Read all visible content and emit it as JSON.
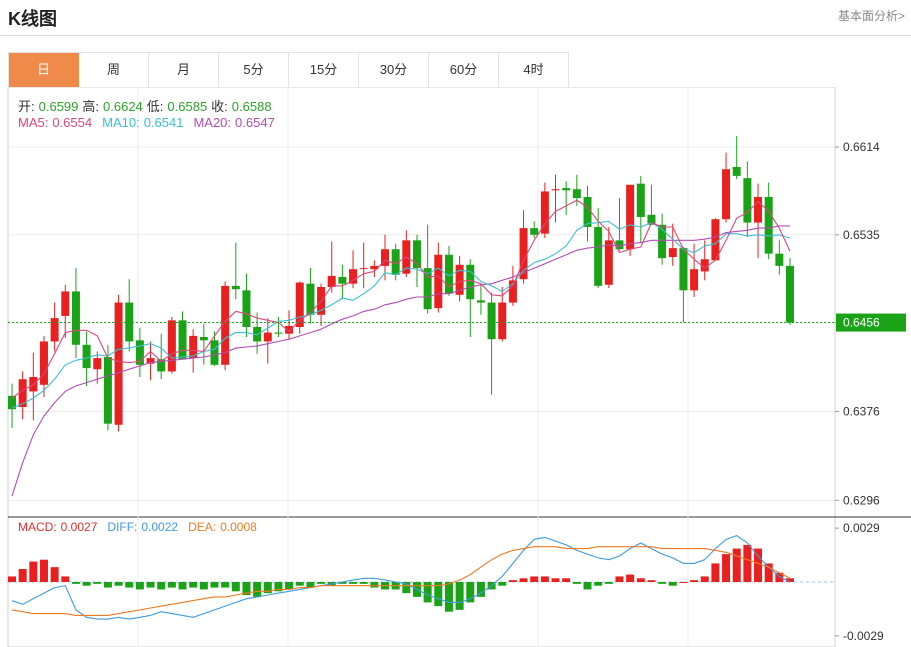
{
  "header": {
    "title": "K线图",
    "more_label": "基本面分析>"
  },
  "tabs": [
    {
      "label": "日",
      "active": true
    },
    {
      "label": "周",
      "active": false
    },
    {
      "label": "月",
      "active": false
    },
    {
      "label": "5分",
      "active": false
    },
    {
      "label": "15分",
      "active": false
    },
    {
      "label": "30分",
      "active": false
    },
    {
      "label": "60分",
      "active": false
    },
    {
      "label": "4时",
      "active": false
    }
  ],
  "ohlc": [
    {
      "label": "开:",
      "value": "0.6599"
    },
    {
      "label": "高:",
      "value": "0.6624"
    },
    {
      "label": "低:",
      "value": "0.6585"
    },
    {
      "label": "收:",
      "value": "0.6588"
    }
  ],
  "ma": [
    {
      "label": "MA5:",
      "value": "0.6554",
      "color": "#e0457b"
    },
    {
      "label": "MA10:",
      "value": "0.6541",
      "color": "#3cbfd6"
    },
    {
      "label": "MA20:",
      "value": "0.6547",
      "color": "#b14db5"
    }
  ],
  "macd_info": [
    {
      "label": "MACD:",
      "value": "0.0027",
      "color": "#e0302a"
    },
    {
      "label": "DIFF:",
      "value": "0.0022",
      "color": "#3c9be0"
    },
    {
      "label": "DEA:",
      "value": "0.0008",
      "color": "#f07a22"
    }
  ],
  "colors": {
    "up": "#e8201f",
    "down": "#1aa317",
    "ma5": "#e0457b",
    "ma10": "#3cbfd6",
    "ma20": "#b14db5",
    "diff": "#3c9be0",
    "dea": "#f07a22",
    "last": "#1aa317"
  },
  "chart_data": {
    "type": "candlestick",
    "price_axis": {
      "ticks": [
        "0.6614",
        "0.6535",
        "0.6456",
        "0.6376",
        "0.6296"
      ],
      "ylim": [
        0.6281,
        0.6668
      ]
    },
    "last_price": "0.6456",
    "candles": [
      [
        0.639,
        0.6401,
        0.6361,
        0.6378
      ],
      [
        0.638,
        0.6412,
        0.6369,
        0.6405
      ],
      [
        0.6394,
        0.6429,
        0.6368,
        0.6407
      ],
      [
        0.64,
        0.6444,
        0.6389,
        0.6439
      ],
      [
        0.6439,
        0.6474,
        0.643,
        0.646
      ],
      [
        0.6462,
        0.649,
        0.6442,
        0.6484
      ],
      [
        0.6484,
        0.6505,
        0.6424,
        0.6436
      ],
      [
        0.6436,
        0.6448,
        0.6399,
        0.6415
      ],
      [
        0.6414,
        0.643,
        0.6401,
        0.6424
      ],
      [
        0.6425,
        0.6436,
        0.6359,
        0.6365
      ],
      [
        0.6364,
        0.6481,
        0.6358,
        0.6474
      ],
      [
        0.6474,
        0.6495,
        0.643,
        0.6439
      ],
      [
        0.644,
        0.6451,
        0.6407,
        0.6418
      ],
      [
        0.6419,
        0.6439,
        0.6404,
        0.6424
      ],
      [
        0.6423,
        0.6446,
        0.6405,
        0.6412
      ],
      [
        0.6412,
        0.6461,
        0.641,
        0.6458
      ],
      [
        0.6458,
        0.6466,
        0.6423,
        0.6423
      ],
      [
        0.6424,
        0.645,
        0.6411,
        0.6444
      ],
      [
        0.6443,
        0.6455,
        0.6418,
        0.644
      ],
      [
        0.644,
        0.6448,
        0.6417,
        0.6418
      ],
      [
        0.6418,
        0.6493,
        0.6413,
        0.6489
      ],
      [
        0.6489,
        0.6528,
        0.6477,
        0.6486
      ],
      [
        0.6485,
        0.65,
        0.6443,
        0.6452
      ],
      [
        0.6452,
        0.6465,
        0.6428,
        0.6439
      ],
      [
        0.6439,
        0.646,
        0.6419,
        0.6447
      ],
      [
        0.6447,
        0.6461,
        0.6443,
        0.6446
      ],
      [
        0.6446,
        0.6467,
        0.6441,
        0.6453
      ],
      [
        0.6452,
        0.6493,
        0.6446,
        0.6492
      ],
      [
        0.6491,
        0.6505,
        0.6455,
        0.6463
      ],
      [
        0.6463,
        0.6491,
        0.6453,
        0.6488
      ],
      [
        0.6488,
        0.6529,
        0.6483,
        0.6498
      ],
      [
        0.6497,
        0.6508,
        0.6477,
        0.6491
      ],
      [
        0.6491,
        0.6521,
        0.6487,
        0.6504
      ],
      [
        0.6505,
        0.6528,
        0.6487,
        0.6505
      ],
      [
        0.6504,
        0.6512,
        0.6497,
        0.6507
      ],
      [
        0.6507,
        0.6535,
        0.6494,
        0.6522
      ],
      [
        0.6522,
        0.6527,
        0.6494,
        0.6499
      ],
      [
        0.65,
        0.6539,
        0.6497,
        0.653
      ],
      [
        0.653,
        0.6535,
        0.6488,
        0.6505
      ],
      [
        0.6505,
        0.6544,
        0.6464,
        0.6468
      ],
      [
        0.6469,
        0.6528,
        0.6465,
        0.6517
      ],
      [
        0.6517,
        0.6525,
        0.648,
        0.6482
      ],
      [
        0.6481,
        0.6516,
        0.6475,
        0.6508
      ],
      [
        0.6508,
        0.6513,
        0.6443,
        0.6477
      ],
      [
        0.6476,
        0.649,
        0.6463,
        0.6474
      ],
      [
        0.6474,
        0.6483,
        0.6391,
        0.6441
      ],
      [
        0.6441,
        0.6488,
        0.6439,
        0.6474
      ],
      [
        0.6474,
        0.6507,
        0.6471,
        0.6494
      ],
      [
        0.6495,
        0.6557,
        0.6491,
        0.6541
      ],
      [
        0.6541,
        0.6547,
        0.6532,
        0.6535
      ],
      [
        0.6536,
        0.6582,
        0.6532,
        0.6574
      ],
      [
        0.6575,
        0.6589,
        0.6546,
        0.6576
      ],
      [
        0.6577,
        0.6583,
        0.6553,
        0.6575
      ],
      [
        0.6576,
        0.6589,
        0.6561,
        0.6568
      ],
      [
        0.6569,
        0.6579,
        0.6529,
        0.6542
      ],
      [
        0.6542,
        0.6559,
        0.6487,
        0.6489
      ],
      [
        0.649,
        0.6542,
        0.6487,
        0.653
      ],
      [
        0.653,
        0.6568,
        0.6521,
        0.6522
      ],
      [
        0.6522,
        0.6579,
        0.6516,
        0.658
      ],
      [
        0.6581,
        0.6588,
        0.6528,
        0.6551
      ],
      [
        0.6553,
        0.658,
        0.6545,
        0.6544
      ],
      [
        0.6544,
        0.6554,
        0.6508,
        0.6514
      ],
      [
        0.6515,
        0.6545,
        0.6507,
        0.6523
      ],
      [
        0.6523,
        0.6524,
        0.6456,
        0.6485
      ],
      [
        0.6485,
        0.6527,
        0.6479,
        0.6504
      ],
      [
        0.6502,
        0.653,
        0.6494,
        0.6513
      ],
      [
        0.6512,
        0.655,
        0.6513,
        0.6549
      ],
      [
        0.6549,
        0.6609,
        0.6546,
        0.6594
      ],
      [
        0.6596,
        0.6624,
        0.6585,
        0.6588
      ],
      [
        0.6586,
        0.6601,
        0.6533,
        0.6546
      ],
      [
        0.6546,
        0.6581,
        0.6514,
        0.6569
      ],
      [
        0.6569,
        0.6582,
        0.6513,
        0.6518
      ],
      [
        0.6518,
        0.653,
        0.6499,
        0.6507
      ],
      [
        0.6507,
        0.6514,
        0.6454,
        0.6456
      ]
    ],
    "ma5": [
      0.6388,
      0.6395,
      0.64,
      0.641,
      0.6428,
      0.6447,
      0.6449,
      0.6449,
      0.6444,
      0.6424,
      0.6421,
      0.642,
      0.6421,
      0.643,
      0.6421,
      0.6428,
      0.6431,
      0.6431,
      0.643,
      0.6444,
      0.6457,
      0.6466,
      0.6464,
      0.646,
      0.6458,
      0.6456,
      0.6448,
      0.6458,
      0.6465,
      0.6475,
      0.6489,
      0.6489,
      0.6494,
      0.65,
      0.6502,
      0.6512,
      0.6509,
      0.6515,
      0.6509,
      0.6497,
      0.6498,
      0.6488,
      0.6493,
      0.6494,
      0.6491,
      0.6481,
      0.648,
      0.6489,
      0.6512,
      0.653,
      0.6545,
      0.6556,
      0.6561,
      0.6566,
      0.656,
      0.6547,
      0.6538,
      0.6519,
      0.6522,
      0.6524,
      0.6546,
      0.6542,
      0.6542,
      0.6522,
      0.6513,
      0.6505,
      0.6512,
      0.653,
      0.655,
      0.6555,
      0.6565,
      0.6556,
      0.6541,
      0.652
    ],
    "ma10": [
      0.6379,
      0.6383,
      0.6388,
      0.6395,
      0.6405,
      0.6418,
      0.6422,
      0.6424,
      0.6427,
      0.6426,
      0.6432,
      0.6433,
      0.6435,
      0.6437,
      0.6433,
      0.6424,
      0.6425,
      0.6426,
      0.643,
      0.6432,
      0.6442,
      0.6447,
      0.6447,
      0.6445,
      0.6451,
      0.6457,
      0.6458,
      0.6461,
      0.6463,
      0.6467,
      0.6472,
      0.6478,
      0.6476,
      0.6482,
      0.6489,
      0.6501,
      0.6499,
      0.6505,
      0.6504,
      0.65,
      0.6505,
      0.6498,
      0.6503,
      0.6502,
      0.6493,
      0.6489,
      0.6484,
      0.6491,
      0.6503,
      0.651,
      0.6513,
      0.6518,
      0.6525,
      0.6539,
      0.6545,
      0.6546,
      0.6547,
      0.654,
      0.6544,
      0.6542,
      0.6546,
      0.654,
      0.6531,
      0.6522,
      0.6519,
      0.6525,
      0.6527,
      0.6536,
      0.6536,
      0.6534,
      0.6535,
      0.6534,
      0.6535,
      0.6532
    ],
    "ma20": [
      0.63,
      0.633,
      0.6355,
      0.6372,
      0.6384,
      0.6394,
      0.6399,
      0.6402,
      0.6405,
      0.6408,
      0.6411,
      0.6414,
      0.6417,
      0.642,
      0.6421,
      0.6422,
      0.6423,
      0.6424,
      0.6425,
      0.6427,
      0.6429,
      0.6433,
      0.6434,
      0.6435,
      0.6437,
      0.6439,
      0.6441,
      0.6444,
      0.6447,
      0.645,
      0.6455,
      0.6459,
      0.6462,
      0.6466,
      0.6468,
      0.6472,
      0.6474,
      0.6477,
      0.6479,
      0.6479,
      0.6482,
      0.6482,
      0.6485,
      0.6488,
      0.649,
      0.6491,
      0.6494,
      0.6497,
      0.6501,
      0.6505,
      0.6509,
      0.6513,
      0.6517,
      0.6521,
      0.6523,
      0.6524,
      0.6526,
      0.6525,
      0.6527,
      0.6528,
      0.653,
      0.653,
      0.653,
      0.653,
      0.653,
      0.6531,
      0.6533,
      0.6537,
      0.6538,
      0.6539,
      0.6541,
      0.6541,
      0.6543,
      0.6543
    ],
    "macd_axis": {
      "ticks": [
        "0.0029",
        "-0.0029"
      ],
      "ylim": [
        -0.0035,
        0.0035
      ]
    },
    "macd": [
      0.0003,
      0.0007,
      0.0011,
      0.0012,
      0.0008,
      0.0003,
      -0.0001,
      -0.0002,
      -0.0001,
      -0.0003,
      -0.0002,
      -0.0003,
      -0.0004,
      -0.0003,
      -0.0004,
      -0.0003,
      -0.0004,
      -0.0003,
      -0.0004,
      -0.0003,
      -0.0003,
      -0.0005,
      -0.0007,
      -0.0008,
      -0.0006,
      -0.0005,
      -0.0004,
      -0.0002,
      -0.0003,
      -0.0001,
      -0.0002,
      -0.0001,
      -0.0001,
      -0.0001,
      -0.0003,
      -0.0004,
      -0.0004,
      -0.0006,
      -0.0008,
      -0.0011,
      -0.0013,
      -0.0016,
      -0.0015,
      -0.0011,
      -0.0008,
      -0.0004,
      -0.0002,
      0.0001,
      0.0002,
      0.0003,
      0.0003,
      0.0002,
      0.0002,
      -0.0001,
      -0.0004,
      -0.0002,
      -0.0001,
      0.0003,
      0.0004,
      0.0002,
      0.0001,
      -0.0001,
      -0.0002,
      0.0,
      0.0001,
      0.0003,
      0.001,
      0.0015,
      0.0018,
      0.002,
      0.0018,
      0.001,
      0.0005,
      0.0002
    ],
    "diff": [
      -0.001,
      -0.0012,
      -0.0009,
      -0.0006,
      -0.0003,
      -0.0002,
      -0.0015,
      -0.0019,
      -0.002,
      -0.002,
      -0.0019,
      -0.002,
      -0.0019,
      -0.0018,
      -0.0016,
      -0.0017,
      -0.0018,
      -0.0019,
      -0.0017,
      -0.0015,
      -0.0013,
      -0.0011,
      -0.0009,
      -0.0008,
      -0.0007,
      -0.0006,
      -0.0005,
      -0.0004,
      -0.0003,
      -0.0002,
      -0.0001,
      0.0,
      0.0001,
      0.0002,
      0.0002,
      0.0001,
      0.0,
      -0.0001,
      -0.0004,
      -0.0007,
      -0.0009,
      -0.0011,
      -0.0011,
      -0.0009,
      -0.0006,
      -0.0002,
      0.0003,
      0.001,
      0.0017,
      0.0023,
      0.0024,
      0.0022,
      0.002,
      0.0017,
      0.0015,
      0.0013,
      0.0012,
      0.0014,
      0.0018,
      0.0021,
      0.0018,
      0.0015,
      0.0013,
      0.001,
      0.001,
      0.0012,
      0.0018,
      0.0023,
      0.0025,
      0.0021,
      0.0014,
      0.0008,
      0.0003,
      0.0
    ],
    "dea": [
      -0.0015,
      -0.0016,
      -0.0017,
      -0.0017,
      -0.0017,
      -0.0017,
      -0.0018,
      -0.0018,
      -0.0018,
      -0.0018,
      -0.0017,
      -0.0016,
      -0.0015,
      -0.0014,
      -0.0013,
      -0.0012,
      -0.0011,
      -0.001,
      -0.0009,
      -0.0008,
      -0.0008,
      -0.0007,
      -0.0006,
      -0.0005,
      -0.0005,
      -0.0004,
      -0.0004,
      -0.0003,
      -0.0003,
      -0.0002,
      -0.0002,
      -0.0002,
      -0.0002,
      -0.0002,
      -0.0002,
      -0.0002,
      -0.0002,
      -0.0002,
      -0.0002,
      -0.0002,
      -0.0002,
      -0.0001,
      0.0001,
      0.0004,
      0.0008,
      0.0012,
      0.0015,
      0.0017,
      0.0018,
      0.0019,
      0.0019,
      0.0019,
      0.0018,
      0.0018,
      0.0018,
      0.0019,
      0.0019,
      0.0019,
      0.0019,
      0.0019,
      0.0019,
      0.0018,
      0.0018,
      0.0018,
      0.0018,
      0.0018,
      0.0017,
      0.0016,
      0.0014,
      0.0012,
      0.001,
      0.0008,
      0.0005,
      0.0002
    ]
  }
}
